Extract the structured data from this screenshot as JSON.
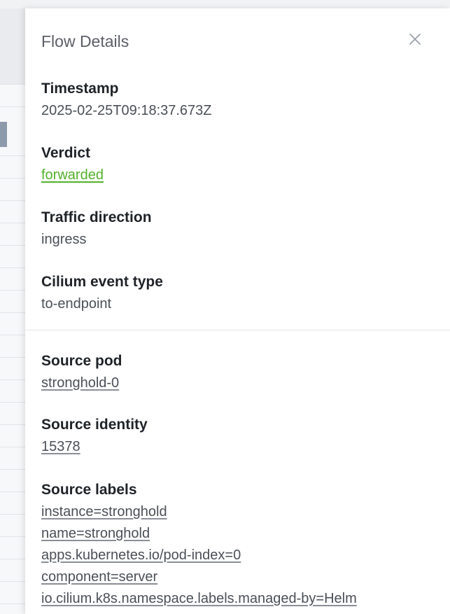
{
  "panel": {
    "title": "Flow Details"
  },
  "fields": {
    "timestamp": {
      "label": "Timestamp",
      "value": "2025-02-25T09:18:37.673Z"
    },
    "verdict": {
      "label": "Verdict",
      "value": "forwarded"
    },
    "traffic_direction": {
      "label": "Traffic direction",
      "value": "ingress"
    },
    "event_type": {
      "label": "Cilium event type",
      "value": "to-endpoint"
    },
    "source_pod": {
      "label": "Source pod",
      "value": "stronghold-0"
    },
    "source_identity": {
      "label": "Source identity",
      "value": "15378"
    },
    "source_labels": {
      "label": "Source labels",
      "items": [
        "instance=stronghold",
        "name=stronghold",
        "apps.kubernetes.io/pod-index=0",
        "component=server",
        "io.cilium.k8s.namespace.labels.managed-by=Helm"
      ]
    }
  },
  "colors": {
    "verdict_forwarded": "#52b02b",
    "label_text": "#1f2328",
    "value_text": "#4b4f57"
  },
  "icons": {
    "close": "close-icon"
  }
}
